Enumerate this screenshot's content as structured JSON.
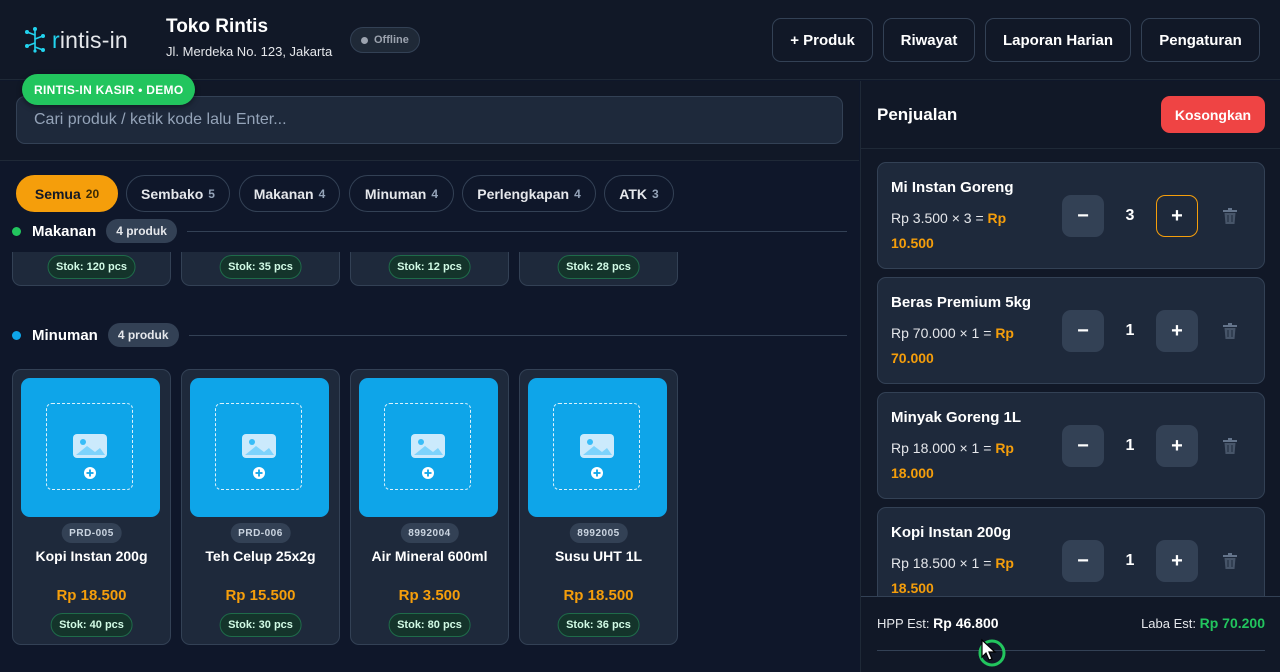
{
  "header": {
    "logo_prefix": "r",
    "logo_rest": "intis-in",
    "store_name": "Toko Rintis",
    "store_address": "Jl. Merdeka No. 123, Jakarta",
    "status": "Offline",
    "buttons": [
      "+ Produk",
      "Riwayat",
      "Laporan Harian",
      "Pengaturan"
    ]
  },
  "search": {
    "placeholder": "Cari produk / ketik kode lalu Enter...",
    "badge": "RINTIS-IN KASIR • DEMO"
  },
  "categories": [
    {
      "label": "Semua",
      "count": "20"
    },
    {
      "label": "Sembako",
      "count": "5"
    },
    {
      "label": "Makanan",
      "count": "4"
    },
    {
      "label": "Minuman",
      "count": "4"
    },
    {
      "label": "Perlengkapan",
      "count": "4"
    },
    {
      "label": "ATK",
      "count": "3"
    }
  ],
  "sections": {
    "makanan": {
      "title": "Makanan",
      "count": "4 produk",
      "stocks": [
        "Stok: 120 pcs",
        "Stok: 35 pcs",
        "Stok: 12 pcs",
        "Stok: 28 pcs"
      ]
    },
    "minuman": {
      "title": "Minuman",
      "count": "4 produk",
      "products": [
        {
          "code": "PRD-005",
          "name": "Kopi Instan 200g",
          "price": "Rp 18.500",
          "stock": "Stok: 40 pcs"
        },
        {
          "code": "PRD-006",
          "name": "Teh Celup 25x2g",
          "price": "Rp 15.500",
          "stock": "Stok: 30 pcs"
        },
        {
          "code": "8992004",
          "name": "Air Mineral 600ml",
          "price": "Rp 3.500",
          "stock": "Stok: 80 pcs"
        },
        {
          "code": "8992005",
          "name": "Susu UHT 1L",
          "price": "Rp 18.500",
          "stock": "Stok: 36 pcs"
        }
      ]
    }
  },
  "cart": {
    "title": "Penjualan",
    "clear_label": "Kosongkan",
    "items": [
      {
        "name": "Mi Instan Goreng",
        "line": "Rp 3.500 × 3 = ",
        "subtotal": "Rp 10.500",
        "qty": "3"
      },
      {
        "name": "Beras Premium 5kg",
        "line": "Rp 70.000 × 1 = ",
        "subtotal": "Rp 70.000",
        "qty": "1"
      },
      {
        "name": "Minyak Goreng 1L",
        "line": "Rp 18.000 × 1 = ",
        "subtotal": "Rp 18.000",
        "qty": "1"
      },
      {
        "name": "Kopi Instan 200g",
        "line": "Rp 18.500 × 1 = ",
        "subtotal": "Rp 18.500",
        "qty": "1"
      }
    ],
    "minus": "−",
    "plus": "+",
    "hpp_label": "HPP Est:",
    "hpp_value": "Rp 46.800",
    "laba_label": "Laba Est:",
    "laba_value": "Rp 70.200"
  },
  "colors": {
    "accent": "#f59e0b",
    "success": "#22c55e",
    "danger": "#ef4444",
    "product_tile": "#0ea5e9"
  },
  "icons": [
    "network-logo-icon",
    "image-placeholder-icon",
    "plus-circle-icon",
    "trash-icon",
    "cursor-icon"
  ]
}
